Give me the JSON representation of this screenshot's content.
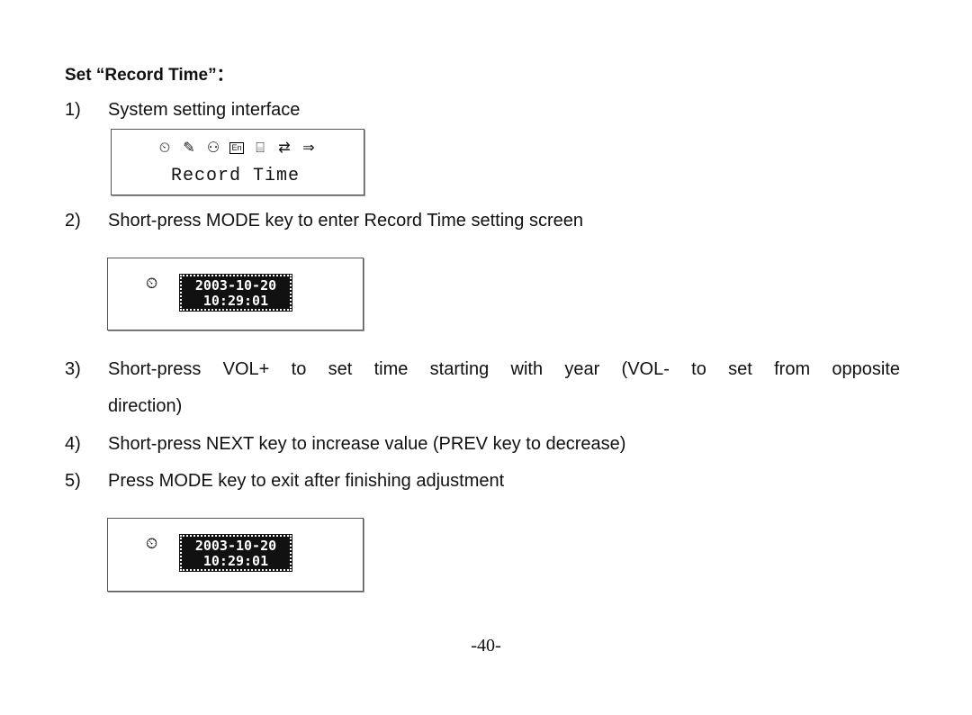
{
  "heading": "Set “Record Time”：",
  "steps": [
    {
      "num": "1)",
      "text": "System setting interface"
    },
    {
      "num": "2)",
      "text": "Short-press MODE key to enter Record Time setting screen"
    },
    {
      "num": "3)",
      "text": "Short-press VOL+ to set time starting with year (VOL- to set from opposite",
      "continuation": "direction)"
    },
    {
      "num": "4)",
      "text": "Short-press NEXT key to increase value (PREV key to decrease)"
    },
    {
      "num": "5)",
      "text": "Press MODE key to exit after finishing adjustment"
    }
  ],
  "screen1": {
    "icons": [
      "clock-icon",
      "microphone-icon",
      "light-bulb-icon",
      "language-icon",
      "disk-icon",
      "repeat-ab-icon",
      "arrow-right-icon"
    ],
    "icon_glyphs": [
      "⏲",
      "✎",
      "⚇",
      "En",
      "⌸",
      "⇄",
      "⇒"
    ],
    "label": "Record Time"
  },
  "screen2": {
    "clock_glyph": "⏲",
    "date": "2003-10-20",
    "time": "10:29:01"
  },
  "screen3": {
    "clock_glyph": "⏲",
    "date": "2003-10-20",
    "time": "10:29:01"
  },
  "page_number": "-40-"
}
